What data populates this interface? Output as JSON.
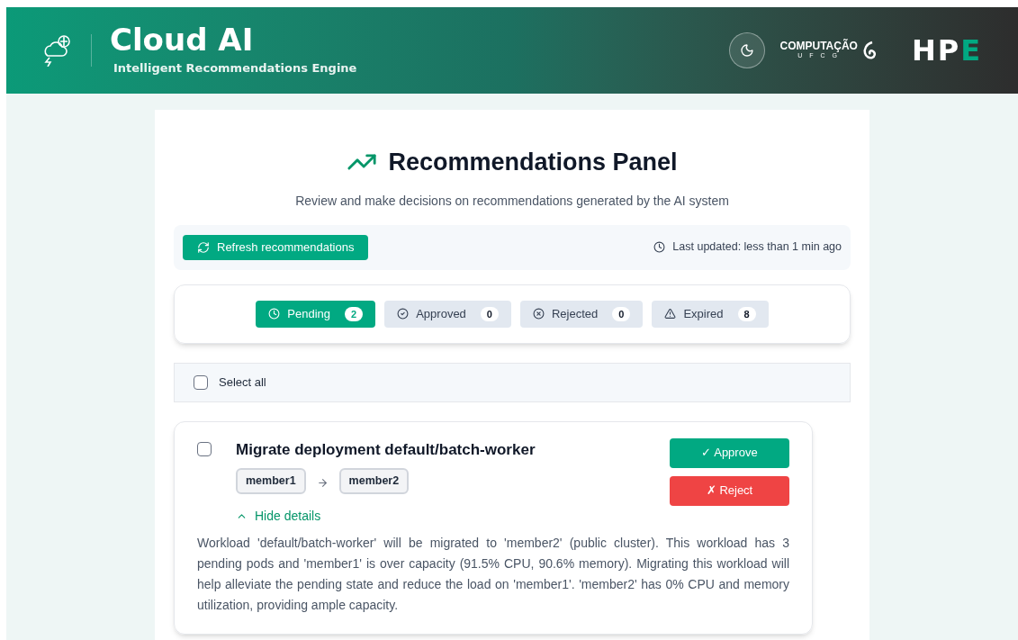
{
  "header": {
    "title": "Cloud AI",
    "subtitle": "Intelligent Recommendations Engine",
    "logos": {
      "computacao": "COMPUTAÇÃO",
      "ufcg": "U F C G",
      "hpe": "HP",
      "hpe_accent": "E"
    }
  },
  "panel": {
    "title": "Recommendations Panel",
    "description": "Review and make decisions on recommendations generated by the AI system"
  },
  "toolbar": {
    "refresh": "Refresh recommendations",
    "last_updated": "Last updated: less than 1 min ago"
  },
  "tabs": [
    {
      "label": "Pending",
      "count": "2",
      "selected": true
    },
    {
      "label": "Approved",
      "count": "0",
      "selected": false
    },
    {
      "label": "Rejected",
      "count": "0",
      "selected": false
    },
    {
      "label": "Expired",
      "count": "8",
      "selected": false
    }
  ],
  "select_all": {
    "label": "Select all",
    "checked": false
  },
  "recommendations": [
    {
      "title": "Migrate deployment default/batch-worker",
      "checked": false,
      "source": "member1",
      "target": "member2",
      "approve": "✓ Approve",
      "reject": "✗ Reject",
      "details_toggle": "Hide details",
      "expanded": true,
      "details": "Workload 'default/batch-worker' will be migrated to 'member2' (public cluster). This workload has 3 pending pods and 'member1' is over capacity (91.5% CPU, 90.6% memory). Migrating this workload will help alleviate the pending state and reduce the load on 'member1'. 'member2' has 0% CPU and memory utilization, providing ample capacity."
    }
  ]
}
